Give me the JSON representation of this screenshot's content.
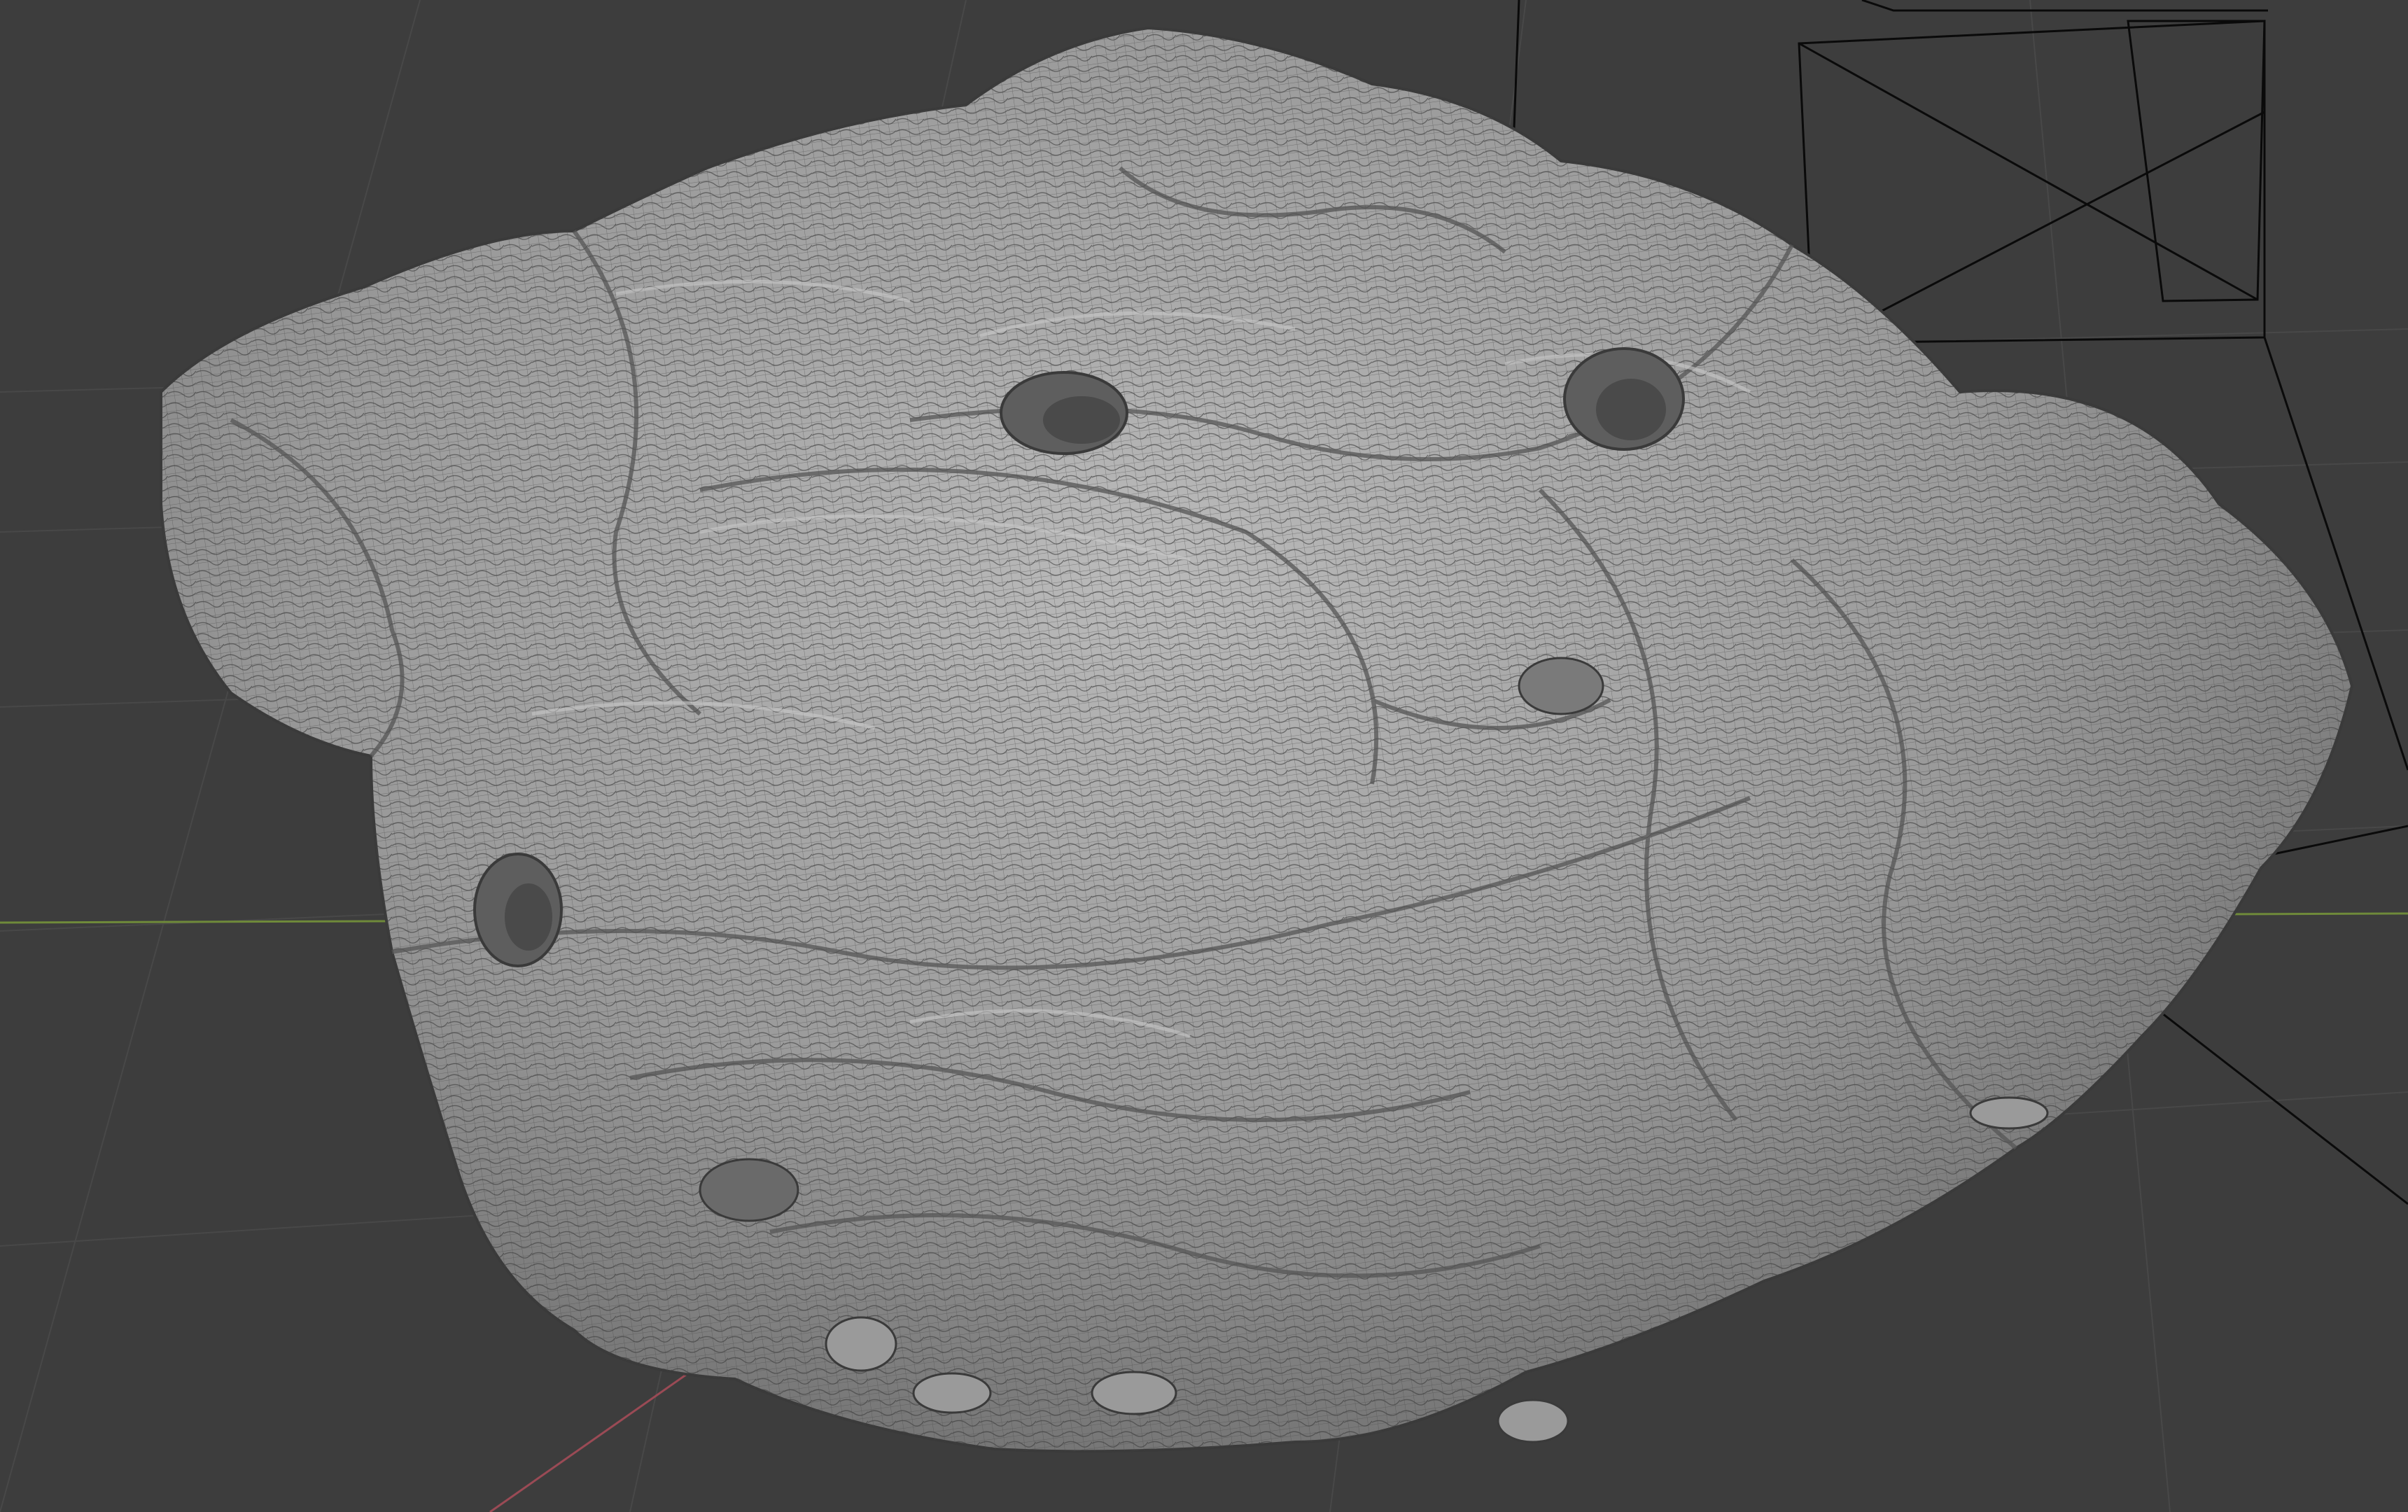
{
  "viewport": {
    "mode": "3d-viewport",
    "shading": "solid",
    "wireframe_overlay": true,
    "object": "sculpted-rock-mesh"
  },
  "colors": {
    "background": "#3d3d3d",
    "grid_line": "#4a4a4a",
    "x_axis": "#9a4a55",
    "y_axis": "#6f8a3a",
    "camera_frame": "#0a0a0a",
    "mesh_light": "#b4b4b4",
    "mesh_mid": "#8e8e8e",
    "mesh_dark": "#5a5a5a",
    "wire": "#3a3a3a"
  }
}
